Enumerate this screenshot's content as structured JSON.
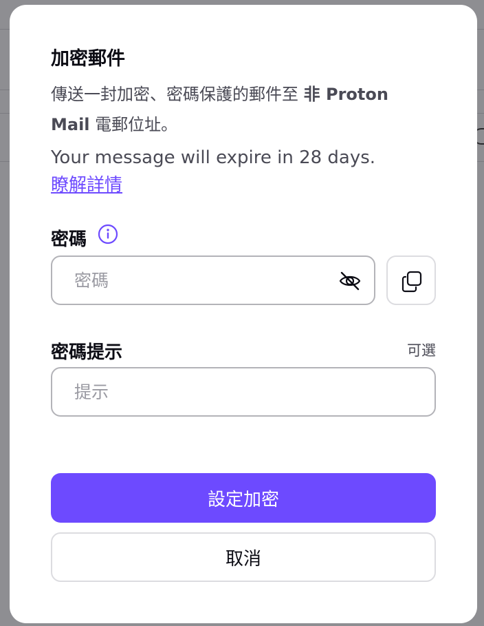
{
  "modal": {
    "title": "加密郵件",
    "description": {
      "part1": "傳送一封加密、密碼保護的郵件至",
      "bold": "非 Proton Mail",
      "part2": "電郵位址。"
    },
    "expire_text": "Your message will expire in 28 days.",
    "learn_more": "瞭解詳情",
    "password": {
      "label": "密碼",
      "placeholder": "密碼",
      "value": ""
    },
    "hint": {
      "label": "密碼提示",
      "optional": "可選",
      "placeholder": "提示",
      "value": ""
    },
    "buttons": {
      "set_encryption": "設定加密",
      "cancel": "取消"
    }
  },
  "colors": {
    "accent": "#6d4aff",
    "text": "#0c0c14",
    "muted": "#4a4a55"
  }
}
